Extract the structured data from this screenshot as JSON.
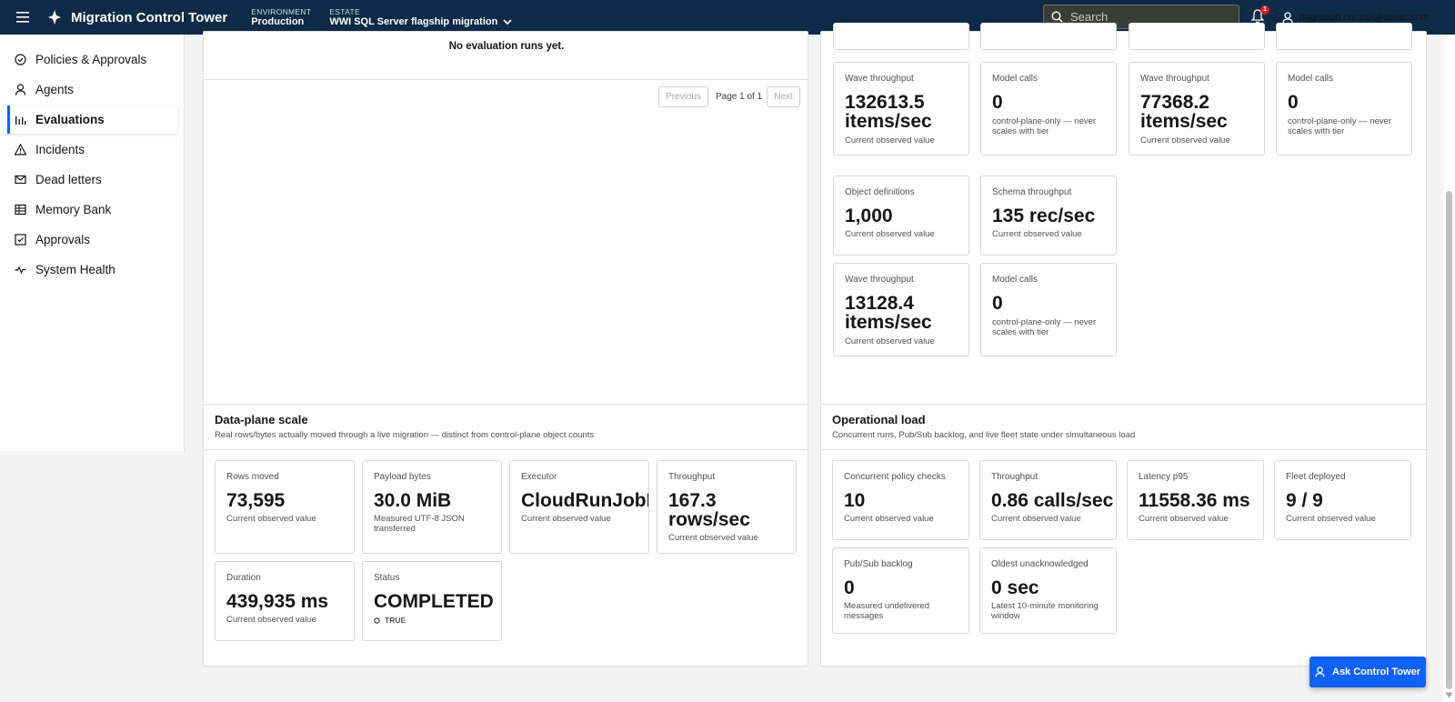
{
  "topbar": {
    "app_title": "Migration Control Tower",
    "environment_label": "ENVIRONMENT",
    "environment_value": "Production",
    "estate_label": "ESTATE",
    "estate_value": "WWI SQL Server flagship migration",
    "search_placeholder": "Search",
    "notification_count": "1",
    "user_email": "migration.control@tower.com"
  },
  "sidebar": {
    "items": [
      {
        "label": "Policies & Approvals",
        "icon": "shield-check-icon"
      },
      {
        "label": "Agents",
        "icon": "person-icon"
      },
      {
        "label": "Evaluations",
        "icon": "bar-chart-icon",
        "active": true
      },
      {
        "label": "Incidents",
        "icon": "warning-icon"
      },
      {
        "label": "Dead letters",
        "icon": "mail-icon"
      },
      {
        "label": "Memory Bank",
        "icon": "table-icon"
      },
      {
        "label": "Approvals",
        "icon": "checkbox-icon"
      },
      {
        "label": "System Health",
        "icon": "pulse-icon"
      }
    ]
  },
  "evaluations": {
    "empty_text": "No evaluation runs yet.",
    "prev_label": "Previous",
    "page_text": "Page 1 of 1",
    "next_label": "Next"
  },
  "scale_cards": [
    {
      "label": "Wave throughput",
      "value": "132613.5 items/sec",
      "sub": "Current observed value"
    },
    {
      "label": "Model calls",
      "value": "0",
      "sub": "control-plane-only — never scales with tier"
    },
    {
      "label": "Wave throughput",
      "value": "77368.2 items/sec",
      "sub": "Current observed value"
    },
    {
      "label": "Model calls",
      "value": "0",
      "sub": "control-plane-only — never scales with tier"
    },
    {
      "label": "Object definitions",
      "value": "1,000",
      "sub": "Current observed value"
    },
    {
      "label": "Schema throughput",
      "value": "135 rec/sec",
      "sub": "Current observed value"
    },
    {
      "label": "Wave throughput",
      "value": "13128.4 items/sec",
      "sub": "Current observed value"
    },
    {
      "label": "Model calls",
      "value": "0",
      "sub": "control-plane-only — never scales with tier"
    }
  ],
  "data_plane": {
    "title": "Data-plane scale",
    "subtitle": "Real rows/bytes actually moved through a live migration — distinct from control-plane object counts",
    "cards": [
      {
        "label": "Rows moved",
        "value": "73,595",
        "sub": "Current observed value"
      },
      {
        "label": "Payload bytes",
        "value": "30.0 MiB",
        "sub": "Measured UTF-8 JSON transferred"
      },
      {
        "label": "Executor",
        "value": "CloudRunJobExecutor",
        "sub": "Current observed value"
      },
      {
        "label": "Throughput",
        "value": "167.3 rows/sec",
        "sub": "Current observed value"
      },
      {
        "label": "Duration",
        "value": "439,935 ms",
        "sub": "Current observed value"
      },
      {
        "label": "Status",
        "value": "COMPLETED",
        "sub": "TRUE"
      }
    ]
  },
  "operational": {
    "title": "Operational load",
    "subtitle": "Concurrent runs, Pub/Sub backlog, and live fleet state under simultaneous load",
    "cards": [
      {
        "label": "Concurrent policy checks",
        "value": "10",
        "sub": "Current observed value"
      },
      {
        "label": "Throughput",
        "value": "0.86 calls/sec",
        "sub": "Current observed value"
      },
      {
        "label": "Latency p95",
        "value": "11558.36 ms",
        "sub": "Current observed value"
      },
      {
        "label": "Fleet deployed",
        "value": "9 / 9",
        "sub": "Current observed value"
      },
      {
        "label": "Pub/Sub backlog",
        "value": "0",
        "sub": "Measured undelivered messages"
      },
      {
        "label": "Oldest unacknowledged",
        "value": "0 sec",
        "sub": "Latest 10-minute monitoring window"
      }
    ]
  },
  "ask_button": "Ask Control Tower"
}
